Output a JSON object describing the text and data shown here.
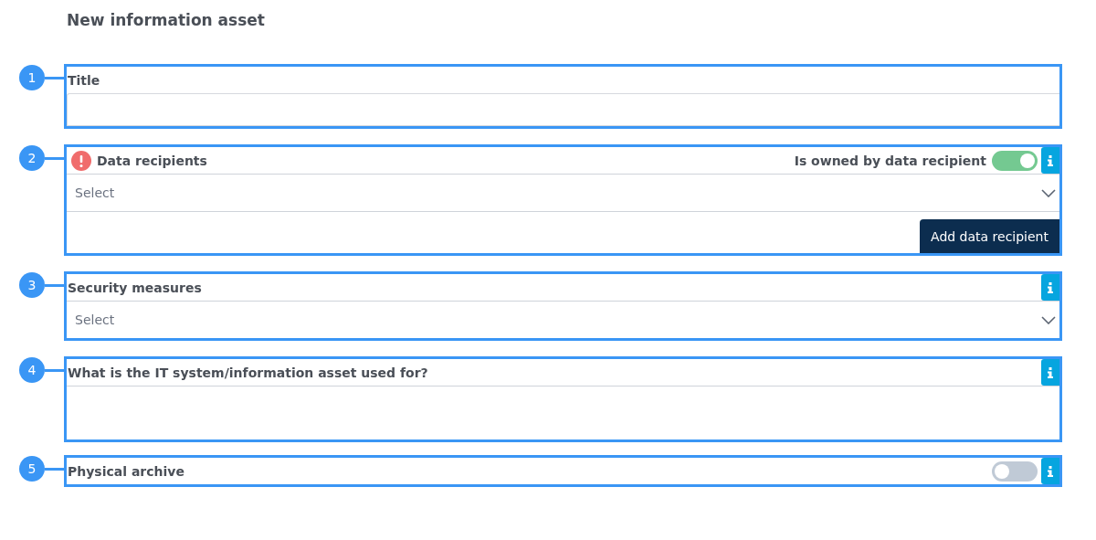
{
  "heading": "New information asset",
  "fields": [
    {
      "number": "1",
      "label": "Title",
      "kind": "text",
      "error": false,
      "info": false
    },
    {
      "number": "2",
      "label": "Data recipients",
      "kind": "select",
      "error": true,
      "info": true,
      "placeholder": "Select",
      "toggle": {
        "label": "Is owned by data recipient",
        "on": true
      },
      "button": "Add data recipient"
    },
    {
      "number": "3",
      "label": "Security measures",
      "kind": "select",
      "error": false,
      "info": true,
      "placeholder": "Select"
    },
    {
      "number": "4",
      "label": "What is the IT system/information asset used for?",
      "kind": "textarea",
      "error": false,
      "info": true
    },
    {
      "number": "5",
      "label": "Physical archive",
      "kind": "switch",
      "error": false,
      "info": true,
      "toggle": {
        "on": false
      }
    }
  ]
}
